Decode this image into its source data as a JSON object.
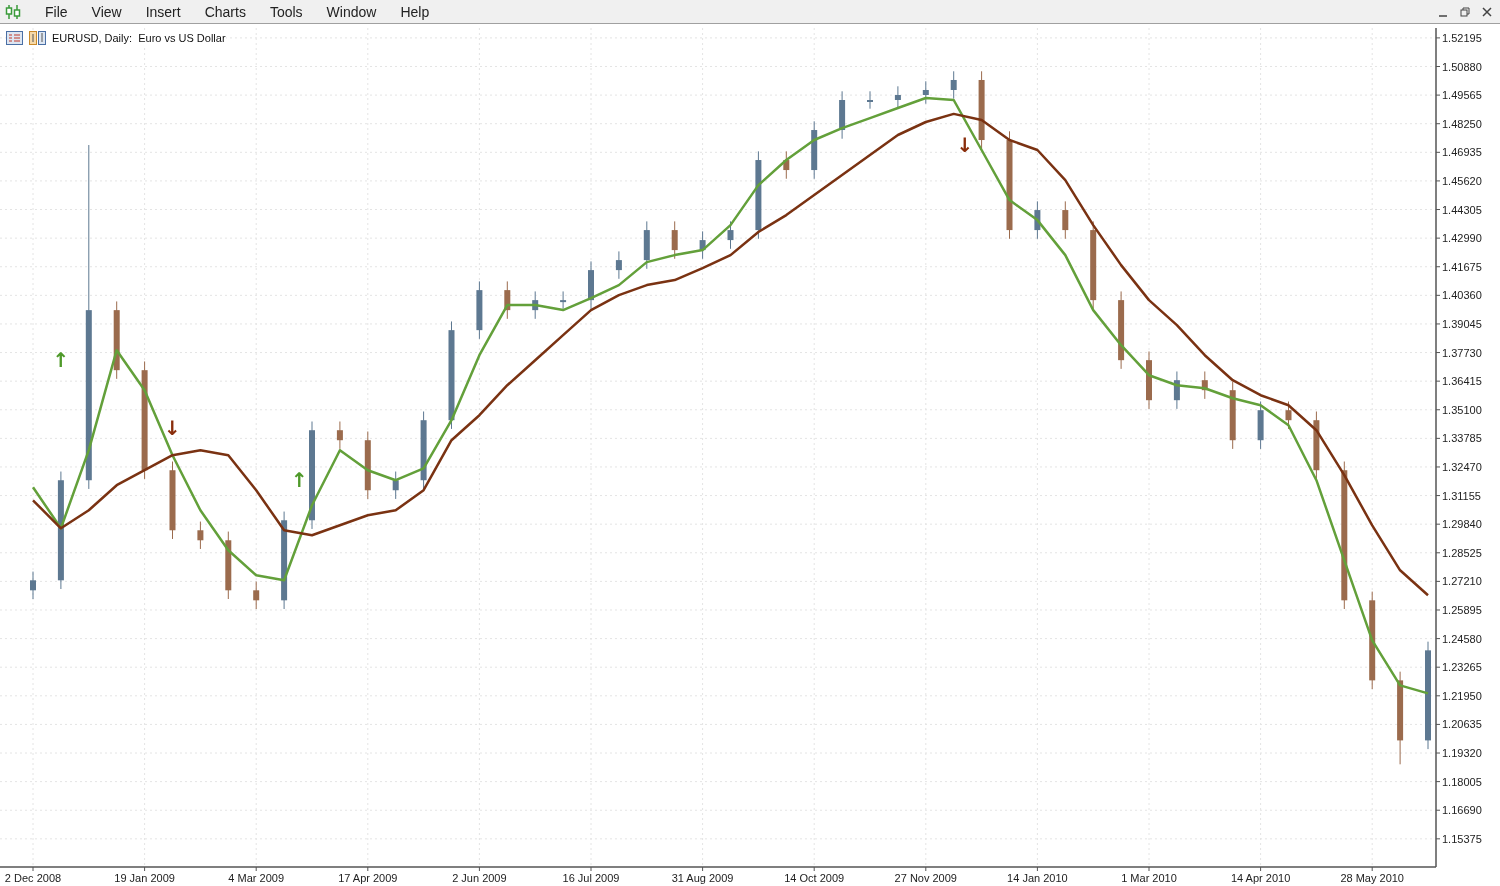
{
  "menu_bar": {
    "items": [
      "File",
      "View",
      "Insert",
      "Charts",
      "Tools",
      "Window",
      "Help"
    ]
  },
  "chart": {
    "title": "EURUSD, Daily:  Euro vs US Dollar",
    "chart_data": {
      "type": "candlestick",
      "grid": true,
      "categories": [
        "2 Dec 2008",
        null,
        null,
        null,
        "19 Jan 2009",
        null,
        null,
        null,
        "4 Mar 2009",
        null,
        null,
        null,
        "17 Apr 2009",
        null,
        null,
        null,
        "2 Jun 2009",
        null,
        null,
        null,
        "16 Jul 2009",
        null,
        null,
        null,
        "31 Aug 2009",
        null,
        null,
        null,
        "14 Oct 2009",
        null,
        null,
        null,
        "27 Nov 2009",
        null,
        null,
        null,
        "14 Jan 2010",
        null,
        null,
        null,
        "1 Mar 2010",
        null,
        null,
        null,
        "14 Apr 2010",
        null,
        null,
        null,
        "28 May 2010",
        null,
        null
      ],
      "ohlc": [
        [
          1.268,
          1.2766,
          1.264,
          1.2726
        ],
        [
          1.2726,
          1.3226,
          1.2686,
          1.3186
        ],
        [
          1.3186,
          1.4727,
          1.3146,
          1.3968
        ],
        [
          1.3968,
          1.4008,
          1.3652,
          1.3692
        ],
        [
          1.3692,
          1.3732,
          1.3192,
          1.3232
        ],
        [
          1.3232,
          1.3272,
          1.2916,
          1.2956
        ],
        [
          1.2956,
          1.2996,
          1.287,
          1.291
        ],
        [
          1.291,
          1.295,
          1.264,
          1.268
        ],
        [
          1.268,
          1.272,
          1.2594,
          1.2634
        ],
        [
          1.2634,
          1.3042,
          1.2594,
          1.3002
        ],
        [
          1.3002,
          1.3456,
          1.2962,
          1.3416
        ],
        [
          1.3416,
          1.3456,
          1.333,
          1.337
        ],
        [
          1.337,
          1.341,
          1.31,
          1.314
        ],
        [
          1.314,
          1.3226,
          1.31,
          1.3186
        ],
        [
          1.3186,
          1.3502,
          1.3146,
          1.3462
        ],
        [
          1.3462,
          1.3916,
          1.3422,
          1.3876
        ],
        [
          1.3876,
          1.41,
          1.3836,
          1.406
        ],
        [
          1.406,
          1.41,
          1.3928,
          1.3968
        ],
        [
          1.3968,
          1.4054,
          1.3928,
          1.4014
        ],
        [
          1.4014,
          1.4054,
          1.3974,
          1.4014
        ],
        [
          1.4014,
          1.4192,
          1.3974,
          1.4152
        ],
        [
          1.4152,
          1.4238,
          1.4112,
          1.4198
        ],
        [
          1.4198,
          1.4376,
          1.4158,
          1.4336
        ],
        [
          1.4336,
          1.4376,
          1.4204,
          1.4244
        ],
        [
          1.4244,
          1.433,
          1.4204,
          1.429
        ],
        [
          1.429,
          1.4376,
          1.425,
          1.4336
        ],
        [
          1.4336,
          1.4698,
          1.4296,
          1.4658
        ],
        [
          1.4658,
          1.4698,
          1.4572,
          1.4612
        ],
        [
          1.4612,
          1.4836,
          1.4572,
          1.4796
        ],
        [
          1.4796,
          1.4974,
          1.4756,
          1.4934
        ],
        [
          1.4934,
          1.4974,
          1.4894,
          1.4934
        ],
        [
          1.4934,
          1.4997,
          1.4894,
          1.4957
        ],
        [
          1.4957,
          1.502,
          1.4917,
          1.498
        ],
        [
          1.498,
          1.5066,
          1.494,
          1.5026
        ],
        [
          1.5026,
          1.5066,
          1.471,
          1.475
        ],
        [
          1.475,
          1.479,
          1.4296,
          1.4336
        ],
        [
          1.4336,
          1.4468,
          1.4296,
          1.4428
        ],
        [
          1.4428,
          1.4468,
          1.4296,
          1.4336
        ],
        [
          1.4336,
          1.4376,
          1.3974,
          1.4014
        ],
        [
          1.4014,
          1.4054,
          1.3698,
          1.3738
        ],
        [
          1.3738,
          1.3778,
          1.3514,
          1.3554
        ],
        [
          1.3554,
          1.3686,
          1.3514,
          1.3646
        ],
        [
          1.3646,
          1.3686,
          1.356,
          1.36
        ],
        [
          1.36,
          1.364,
          1.333,
          1.337
        ],
        [
          1.337,
          1.3548,
          1.333,
          1.3508
        ],
        [
          1.3508,
          1.3548,
          1.3422,
          1.3462
        ],
        [
          1.3462,
          1.3502,
          1.3192,
          1.3232
        ],
        [
          1.3232,
          1.3272,
          1.2594,
          1.2634
        ],
        [
          1.2634,
          1.2674,
          1.2226,
          1.2266
        ],
        [
          1.2266,
          1.2306,
          1.188,
          1.199
        ],
        [
          1.199,
          1.2444,
          1.195,
          1.2404
        ]
      ],
      "series": [
        {
          "type": "line",
          "color": "#63a03a",
          "values": [
            1.3154,
            1.2965,
            1.3324,
            1.3784,
            1.36,
            1.3301,
            1.3048,
            1.2864,
            1.2749,
            1.2726,
            1.3071,
            1.3324,
            1.3232,
            1.3186,
            1.3241,
            1.3462,
            1.3761,
            1.3991,
            1.3991,
            1.3968,
            1.4023,
            1.4083,
            1.4189,
            1.4221,
            1.4244,
            1.4359,
            1.4543,
            1.4658,
            1.475,
            1.4805,
            1.4851,
            1.4897,
            1.4943,
            1.4934,
            1.4704,
            1.4474,
            1.4382,
            1.4221,
            1.3968,
            1.3807,
            1.3669,
            1.3623,
            1.3609,
            1.3563,
            1.3531,
            1.3439,
            1.3186,
            1.2818,
            1.245,
            1.2243,
            1.2206
          ]
        },
        {
          "type": "line",
          "color": "#7a3212",
          "values": [
            1.3094,
            1.2965,
            1.3048,
            1.3163,
            1.3232,
            1.3301,
            1.3324,
            1.3301,
            1.314,
            1.2956,
            1.2933,
            1.2979,
            1.3025,
            1.3048,
            1.314,
            1.337,
            1.3485,
            1.3623,
            1.3738,
            1.3853,
            1.3968,
            1.4037,
            1.4083,
            1.4106,
            1.4161,
            1.4221,
            1.4327,
            1.4405,
            1.4497,
            1.4589,
            1.4681,
            1.4773,
            1.4833,
            1.487,
            1.4842,
            1.475,
            1.4704,
            1.4566,
            1.4359,
            1.4175,
            1.4014,
            1.3899,
            1.3761,
            1.3646,
            1.3577,
            1.3531,
            1.3416,
            1.3209,
            1.2979,
            1.2772,
            1.2657
          ]
        }
      ],
      "ylim": [
        1.1408,
        1.5265
      ],
      "annotations": [
        "↑",
        "↓",
        "↑",
        "↓"
      ],
      "yticks": [
        {
          "value": 1.52195,
          "label": "1.52195"
        },
        {
          "value": 1.5088,
          "label": "1.50880"
        },
        {
          "value": 1.49565,
          "label": "1.49565"
        },
        {
          "value": 1.4825,
          "label": "1.48250"
        },
        {
          "value": 1.46935,
          "label": "1.46935"
        },
        {
          "value": 1.4562,
          "label": "1.45620"
        },
        {
          "value": 1.44305,
          "label": "1.44305"
        },
        {
          "value": 1.4299,
          "label": "1.42990"
        },
        {
          "value": 1.41675,
          "label": "1.41675"
        },
        {
          "value": 1.4036,
          "label": "1.40360"
        },
        {
          "value": 1.39045,
          "label": "1.39045"
        },
        {
          "value": 1.3773,
          "label": "1.37730"
        },
        {
          "value": 1.36415,
          "label": "1.36415"
        },
        {
          "value": 1.351,
          "label": "1.35100"
        },
        {
          "value": 1.33785,
          "label": "1.33785"
        },
        {
          "value": 1.3247,
          "label": "1.32470"
        },
        {
          "value": 1.31155,
          "label": "1.31155"
        },
        {
          "value": 1.2984,
          "label": "1.29840"
        },
        {
          "value": 1.28525,
          "label": "1.28525"
        },
        {
          "value": 1.2721,
          "label": "1.27210"
        },
        {
          "value": 1.25895,
          "label": "1.25895"
        },
        {
          "value": 1.2458,
          "label": "1.24580"
        },
        {
          "value": 1.23265,
          "label": "1.23265"
        },
        {
          "value": 1.2195,
          "label": "1.21950"
        },
        {
          "value": 1.20635,
          "label": "1.20635"
        },
        {
          "value": 1.1932,
          "label": "1.19320"
        },
        {
          "value": 1.18005,
          "label": "1.18005"
        },
        {
          "value": 1.1669,
          "label": "1.16690"
        },
        {
          "value": 1.15375,
          "label": "1.15375"
        }
      ]
    }
  }
}
